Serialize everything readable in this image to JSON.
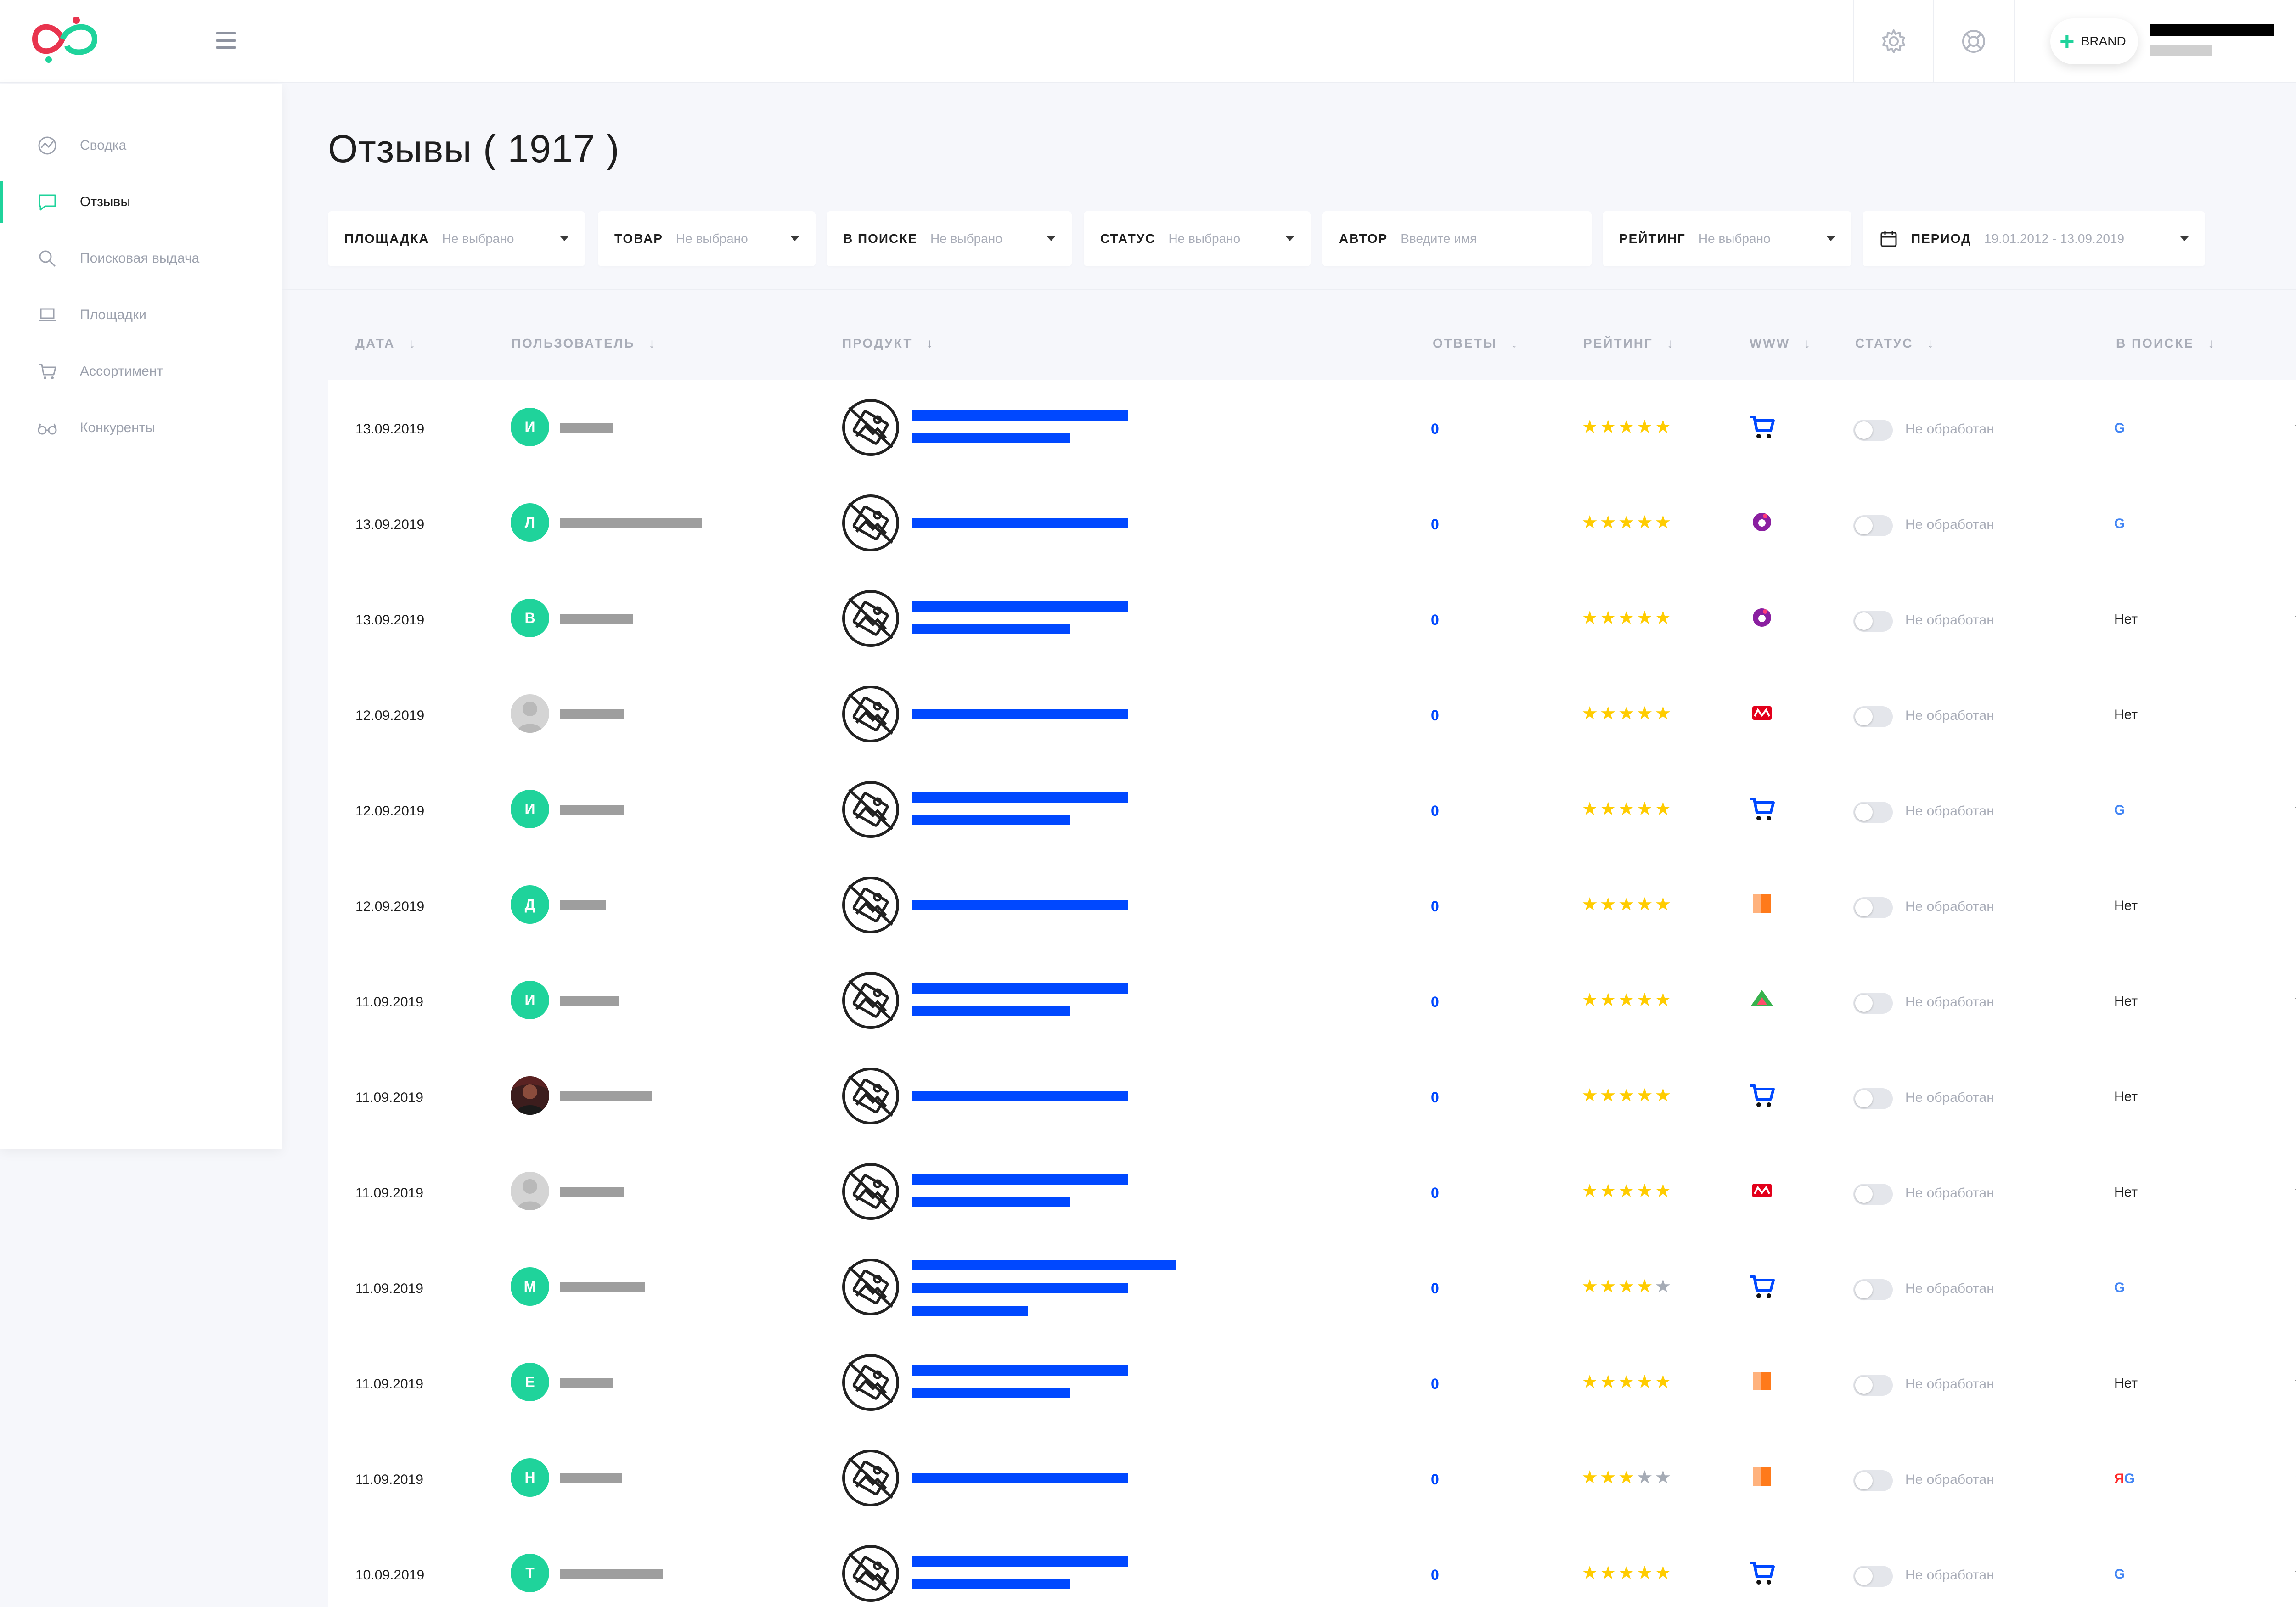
{
  "header": {
    "brand_button_label": "BRAND"
  },
  "sidebar": {
    "items": [
      {
        "label": "Сводка",
        "icon": "summary-icon",
        "active": false
      },
      {
        "label": "Отзывы",
        "icon": "reviews-icon",
        "active": true
      },
      {
        "label": "Поисковая выдача",
        "icon": "search-icon",
        "active": false
      },
      {
        "label": "Площадки",
        "icon": "laptop-icon",
        "active": false
      },
      {
        "label": "Ассортимент",
        "icon": "cart-icon",
        "active": false
      },
      {
        "label": "Конкуренты",
        "icon": "glasses-icon",
        "active": false
      }
    ]
  },
  "page": {
    "title": "Отзывы ( 1917 )"
  },
  "filters": [
    {
      "label": "ПЛОЩАДКА",
      "value": "Не выбрано"
    },
    {
      "label": "ТОВАР",
      "value": "Не выбрано"
    },
    {
      "label": "В ПОИСКЕ",
      "value": "Не выбрано"
    },
    {
      "label": "СТАТУС",
      "value": "Не выбрано"
    },
    {
      "label": "АВТОР",
      "placeholder": "Введите имя"
    },
    {
      "label": "РЕЙТИНГ",
      "value": "Не выбрано"
    },
    {
      "label": "ПЕРИОД",
      "value": "19.01.2012 - 13.09.2019"
    }
  ],
  "table": {
    "columns": [
      "ДАТА",
      "ПОЛЬЗОВАТЕЛЬ",
      "ПРОДУКТ",
      "ОТВЕТЫ",
      "РЕЙТИНГ",
      "WWW",
      "СТАТУС",
      "В ПОИСКЕ"
    ],
    "sort_arrow": "↓",
    "rows": [
      {
        "date": "13.09.2019",
        "initial": "И",
        "avatar": "letter",
        "answers": "0",
        "rating": 5,
        "www": "cart",
        "status": "Не обработан",
        "in_search": "G"
      },
      {
        "date": "13.09.2019",
        "initial": "Л",
        "avatar": "letter",
        "answers": "0",
        "rating": 5,
        "www": "otzovik",
        "status": "Не обработан",
        "in_search": "G"
      },
      {
        "date": "13.09.2019",
        "initial": "В",
        "avatar": "letter",
        "answers": "0",
        "rating": 5,
        "www": "otzovik",
        "status": "Не обработан",
        "in_search": "Нет"
      },
      {
        "date": "12.09.2019",
        "initial": "",
        "avatar": "photo",
        "answers": "0",
        "rating": 5,
        "www": "market-red",
        "status": "Не обработан",
        "in_search": "Нет"
      },
      {
        "date": "12.09.2019",
        "initial": "И",
        "avatar": "letter",
        "answers": "0",
        "rating": 5,
        "www": "cart",
        "status": "Не обработан",
        "in_search": "G"
      },
      {
        "date": "12.09.2019",
        "initial": "Д",
        "avatar": "letter",
        "answers": "0",
        "rating": 5,
        "www": "orange-square",
        "status": "Не обработан",
        "in_search": "Нет"
      },
      {
        "date": "11.09.2019",
        "initial": "И",
        "avatar": "letter",
        "answers": "0",
        "rating": 5,
        "www": "triangle-green",
        "status": "Не обработан",
        "in_search": "Нет"
      },
      {
        "date": "11.09.2019",
        "initial": "",
        "avatar": "photo-dark",
        "answers": "0",
        "rating": 5,
        "www": "cart",
        "status": "Не обработан",
        "in_search": "Нет"
      },
      {
        "date": "11.09.2019",
        "initial": "",
        "avatar": "photo",
        "answers": "0",
        "rating": 5,
        "www": "market-red",
        "status": "Не обработан",
        "in_search": "Нет"
      },
      {
        "date": "11.09.2019",
        "initial": "М",
        "avatar": "letter",
        "answers": "0",
        "rating": 4,
        "www": "cart",
        "status": "Не обработан",
        "in_search": "G"
      },
      {
        "date": "11.09.2019",
        "initial": "Е",
        "avatar": "letter",
        "answers": "0",
        "rating": 5,
        "www": "orange-square",
        "status": "Не обработан",
        "in_search": "Нет"
      },
      {
        "date": "11.09.2019",
        "initial": "Н",
        "avatar": "letter",
        "answers": "0",
        "rating": 3,
        "www": "orange-square",
        "status": "Не обработан",
        "in_search": "ЯG"
      },
      {
        "date": "10.09.2019",
        "initial": "Т",
        "avatar": "letter",
        "answers": "0",
        "rating": 5,
        "www": "cart",
        "status": "Не обработан",
        "in_search": "G"
      }
    ]
  },
  "colors": {
    "accent": "#1fd39b",
    "link": "#0048ff",
    "star": "#ffcc00",
    "star_off": "#a5abb5",
    "google": "#4285f4"
  }
}
